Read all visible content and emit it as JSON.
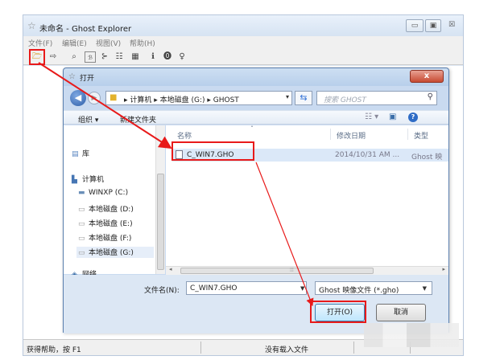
{
  "main_window": {
    "title": "未命名 - Ghost Explorer",
    "controls": {
      "minimize": "▭",
      "maximize": "▣",
      "close": "☒"
    },
    "menu": [
      "文件(F)",
      "编辑(E)",
      "视图(V)",
      "帮助(H)"
    ],
    "toolbar_icons": [
      "open-folder-icon",
      "export-icon",
      "zoom-icon",
      "file-view-icon",
      "tree-icon",
      "grid-icon",
      "info-icon",
      "help-icon",
      "about-icon"
    ],
    "status_left": "获得帮助，按 F1",
    "status_center": "没有载入文件"
  },
  "dialog": {
    "title": "打开",
    "close_label": "x",
    "address": {
      "path": "▸ 计算机 ▸ 本地磁盘 (G:) ▸ GHOST",
      "search_placeholder": "搜索 GHOST"
    },
    "toolbar": {
      "organize": "组织 ▾",
      "new_folder": "新建文件夹"
    },
    "nav": {
      "library": "库",
      "computer": "计算机",
      "drives": [
        "WINXP (C:)",
        "本地磁盘 (D:)",
        "本地磁盘 (E:)",
        "本地磁盘 (F:)",
        "本地磁盘 (G:)"
      ],
      "network": "网络"
    },
    "columns": {
      "name": "名称",
      "modified": "修改日期",
      "type": "类型"
    },
    "files": [
      {
        "name": "C_WIN7.GHO",
        "modified": "2014/10/31 AM ...",
        "type": "Ghost 映"
      }
    ],
    "filename_label": "文件名(N):",
    "filename_value": "C_WIN7.GHO",
    "filetype_value": "Ghost 映像文件 (*.gho)",
    "open_button": "打开(O)",
    "cancel_button": "取消"
  },
  "colors": {
    "highlight": "#e81a1a",
    "selection": "#dbe8f8",
    "dialog_frame": "#c9daf0"
  }
}
